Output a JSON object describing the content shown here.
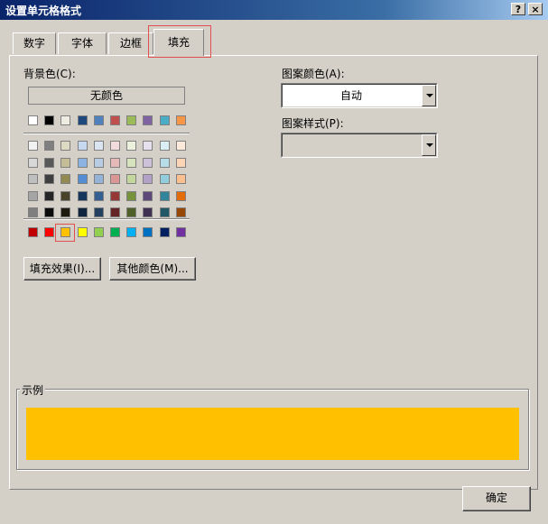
{
  "window": {
    "title": "设置单元格格式",
    "help_btn": "?",
    "close_btn": "×"
  },
  "tabs": [
    {
      "label": "数字",
      "active": false
    },
    {
      "label": "字体",
      "active": false
    },
    {
      "label": "边框",
      "active": false
    },
    {
      "label": "填充",
      "active": true
    }
  ],
  "fill": {
    "background_color_label": "背景色(C):",
    "no_color_button": "无颜色",
    "theme_top_row": [
      "#ffffff",
      "#000000",
      "#eeece1",
      "#1f497d",
      "#4f81bd",
      "#c0504d",
      "#9bbb59",
      "#8064a2",
      "#4bacc6",
      "#f79646"
    ],
    "theme_rows": [
      [
        "#f2f2f2",
        "#7f7f7f",
        "#ddd9c3",
        "#c6d9f0",
        "#dbe5f1",
        "#f2dcdb",
        "#ebf1dd",
        "#e5e0ec",
        "#dbeef3",
        "#fdeada"
      ],
      [
        "#d8d8d8",
        "#595959",
        "#c4bd97",
        "#8db3e2",
        "#b8cce4",
        "#e5b9b7",
        "#d7e3bc",
        "#ccc1d9",
        "#b7dde8",
        "#fbd5b5"
      ],
      [
        "#bfbfbf",
        "#3f3f3f",
        "#938953",
        "#548dd4",
        "#95b3d7",
        "#d99694",
        "#c3d69b",
        "#b2a2c7",
        "#92cddc",
        "#fac08f"
      ],
      [
        "#a5a5a5",
        "#262626",
        "#494429",
        "#17365d",
        "#366092",
        "#953734",
        "#76923c",
        "#5f497a",
        "#31859b",
        "#e36c09"
      ],
      [
        "#7f7f7f",
        "#0c0c0c",
        "#1d1b10",
        "#0f243e",
        "#244061",
        "#632423",
        "#4f6128",
        "#3f3151",
        "#205867",
        "#974806"
      ]
    ],
    "standard_row": [
      "#c00000",
      "#ff0000",
      "#ffc000",
      "#ffff00",
      "#92d050",
      "#00b050",
      "#00b0f0",
      "#0070c0",
      "#002060",
      "#7030a0"
    ],
    "selected_color": "#ffc000",
    "fill_effects_button": "填充效果(I)...",
    "more_colors_button": "其他颜色(M)...",
    "pattern_color_label": "图案颜色(A):",
    "pattern_color_value": "自动",
    "pattern_style_label": "图案样式(P):",
    "pattern_style_value": ""
  },
  "sample": {
    "title": "示例",
    "color": "#ffc000"
  },
  "footer": {
    "ok_button": "确定"
  }
}
